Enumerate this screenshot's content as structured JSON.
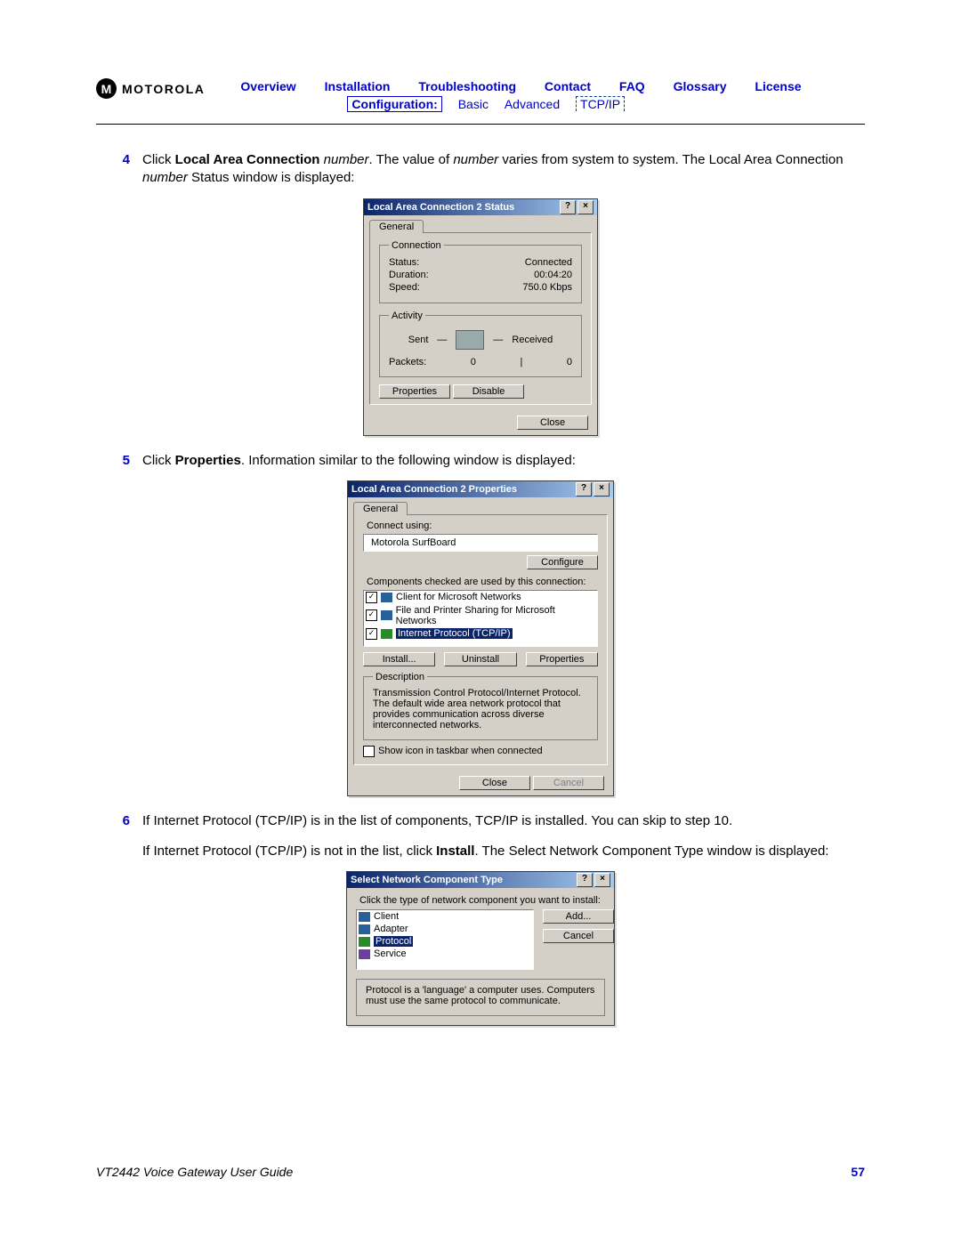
{
  "logo_text": "MOTOROLA",
  "nav": {
    "row1": [
      "Overview",
      "Installation",
      "Troubleshooting",
      "Contact",
      "FAQ",
      "Glossary",
      "License"
    ],
    "config_label": "Configuration:",
    "row2": [
      "Basic",
      "Advanced",
      "TCP/IP"
    ]
  },
  "steps": {
    "s4": {
      "num": "4",
      "pre": "Click ",
      "bold": "Local Area Connection",
      "post1": " ",
      "it1": "number",
      "post2": ". The value of ",
      "it2": "number",
      "post3": " varies from system to system. The Local Area Connection ",
      "it3": "number",
      "post4": " Status window is displayed:"
    },
    "s5": {
      "num": "5",
      "pre": "Click ",
      "bold": "Properties",
      "post": ". Information similar to the following window is displayed:"
    },
    "s6": {
      "num": "6",
      "p1": "If Internet Protocol (TCP/IP) is in the list of components, TCP/IP is installed. You can skip to step 10.",
      "p2a": "If Internet Protocol (TCP/IP) is not in the list, click ",
      "p2bold": "Install",
      "p2b": ". The Select Network Component Type window is displayed:"
    }
  },
  "dlg_status": {
    "title": "Local Area Connection 2 Status",
    "tab": "General",
    "grp_conn": "Connection",
    "rows": [
      {
        "k": "Status:",
        "v": "Connected"
      },
      {
        "k": "Duration:",
        "v": "00:04:20"
      },
      {
        "k": "Speed:",
        "v": "750.0 Kbps"
      }
    ],
    "grp_act": "Activity",
    "sent": "Sent",
    "recv": "Received",
    "packets_lbl": "Packets:",
    "packets_sent": "0",
    "packets_recv": "0",
    "btn_props": "Properties",
    "btn_disable": "Disable",
    "btn_close": "Close"
  },
  "dlg_props": {
    "title": "Local Area Connection 2 Properties",
    "tab": "General",
    "connect_using": "Connect using:",
    "adapter": "Motorola SurfBoard",
    "btn_configure": "Configure",
    "components_hint": "Components checked are used by this connection:",
    "components": [
      "Client for Microsoft Networks",
      "File and Printer Sharing for Microsoft Networks",
      "Internet Protocol (TCP/IP)"
    ],
    "btn_install": "Install...",
    "btn_uninstall": "Uninstall",
    "btn_props": "Properties",
    "grp_desc": "Description",
    "desc": "Transmission Control Protocol/Internet Protocol. The default wide area network protocol that provides communication across diverse interconnected networks.",
    "show_icon": "Show icon in taskbar when connected",
    "btn_close": "Close",
    "btn_cancel": "Cancel"
  },
  "dlg_select": {
    "title": "Select Network Component Type",
    "hint": "Click the type of network component you want to install:",
    "items": [
      "Client",
      "Adapter",
      "Protocol",
      "Service"
    ],
    "btn_add": "Add...",
    "btn_cancel": "Cancel",
    "desc": "Protocol is a 'language' a computer uses. Computers must use the same protocol to communicate."
  },
  "footer": {
    "title": "VT2442 Voice Gateway User Guide",
    "page": "57"
  }
}
